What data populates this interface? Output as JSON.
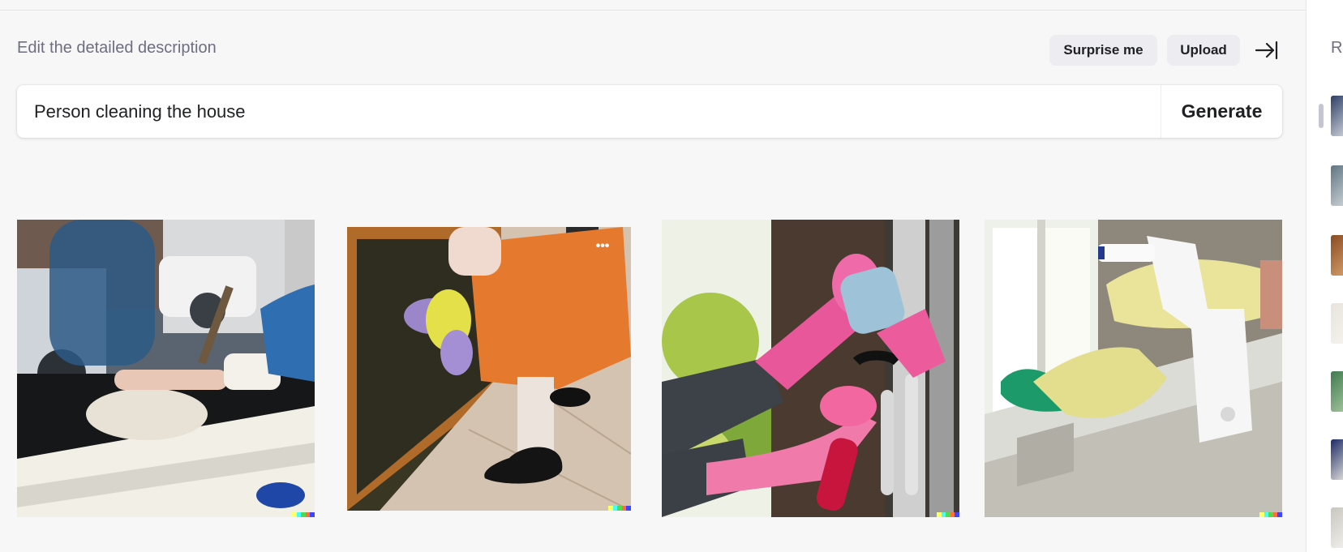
{
  "header": {
    "label": "Edit the detailed description",
    "surprise_label": "Surprise me",
    "upload_label": "Upload"
  },
  "prompt": {
    "value": "Person cleaning the house",
    "generate_label": "Generate"
  },
  "results": {
    "more_label": "•••",
    "images": [
      {
        "name": "result-image-1"
      },
      {
        "name": "result-image-2"
      },
      {
        "name": "result-image-3"
      },
      {
        "name": "result-image-4"
      }
    ]
  },
  "sidebar": {
    "label": "R"
  },
  "colors": {
    "background": "#f7f7f8",
    "chip": "#ececf1",
    "text": "#202123",
    "muted": "#6e6e80",
    "signature": [
      "#ffff66",
      "#42ffff",
      "#51da4c",
      "#ff6e3c",
      "#3c46ff"
    ]
  }
}
